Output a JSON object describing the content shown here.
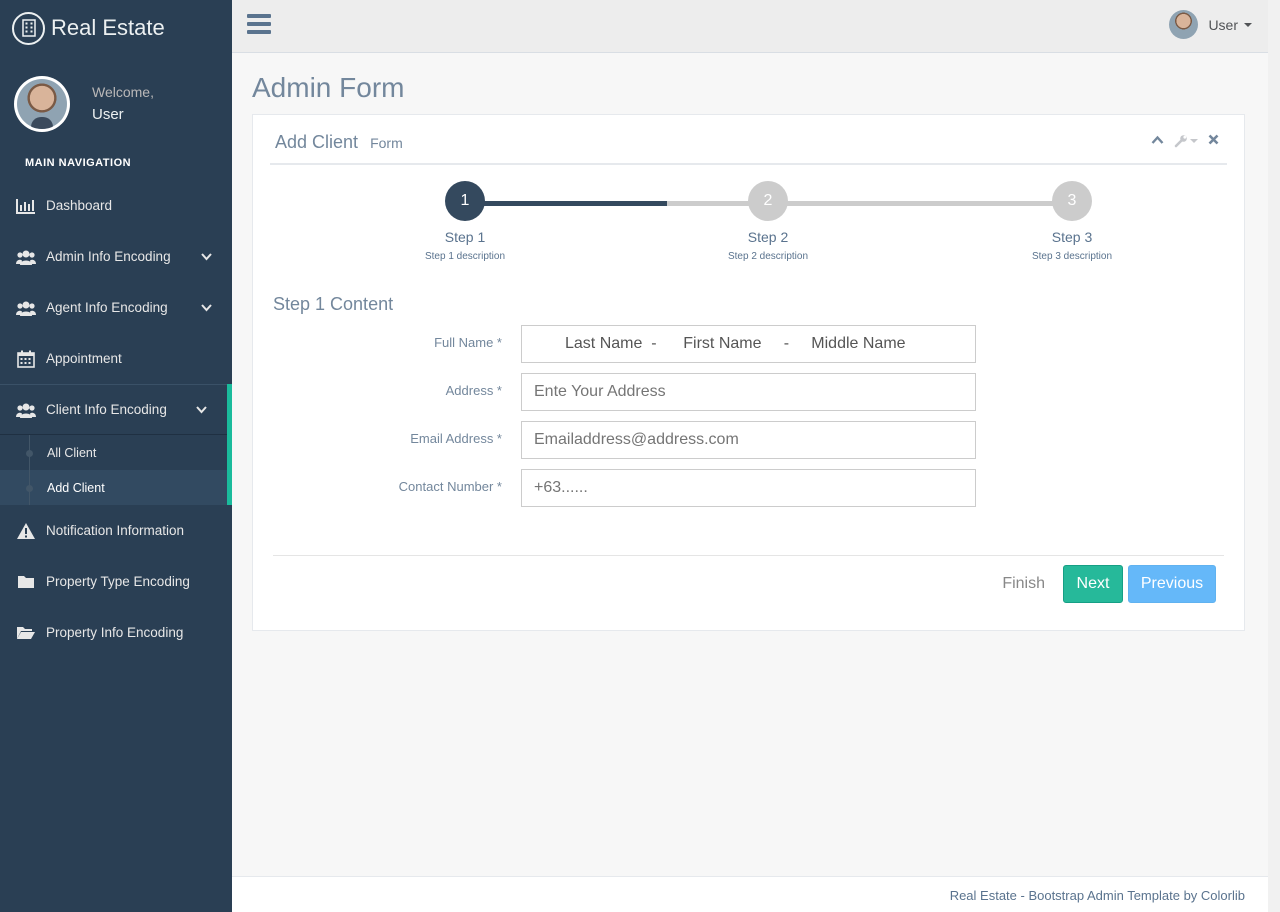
{
  "brand": {
    "title": "Real Estate",
    "icon": "building-icon"
  },
  "profile": {
    "welcome": "Welcome,",
    "name": "User"
  },
  "sidebar": {
    "section_title": "MAIN NAVIGATION",
    "items": [
      {
        "label": "Dashboard",
        "icon": "bar-chart-icon"
      },
      {
        "label": "Admin Info Encoding",
        "icon": "users-icon",
        "expandable": true
      },
      {
        "label": "Agent Info Encoding",
        "icon": "users-icon",
        "expandable": true
      },
      {
        "label": "Appointment",
        "icon": "calendar-icon"
      },
      {
        "label": "Client Info Encoding",
        "icon": "users-icon",
        "expandable": true,
        "active": true
      },
      {
        "label": "Notification Information",
        "icon": "warning-icon"
      },
      {
        "label": "Property Type Encoding",
        "icon": "folder-icon"
      },
      {
        "label": "Property Info Encoding",
        "icon": "folder-open-icon"
      }
    ],
    "client_sub_items": [
      {
        "label": "All Client"
      },
      {
        "label": "Add Client",
        "current": true
      }
    ]
  },
  "topnav": {
    "user_label": "User"
  },
  "page": {
    "title": "Admin Form"
  },
  "panel": {
    "title": "Add Client",
    "subtitle": "Form"
  },
  "wizard": {
    "progress_fraction": 0.25,
    "steps": [
      {
        "number": "1",
        "label": "Step 1",
        "description": "Step 1 description",
        "done": true
      },
      {
        "number": "2",
        "label": "Step 2",
        "description": "Step 2 description",
        "done": false
      },
      {
        "number": "3",
        "label": "Step 3",
        "description": "Step 3 description",
        "done": false
      }
    ],
    "content_title": "Step 1 Content"
  },
  "form": {
    "full_name": {
      "label": "Full Name *",
      "last": "Last Name",
      "sep1": "  -      ",
      "first": "First Name",
      "sep2": "     -     ",
      "middle": "Middle Name"
    },
    "address": {
      "label": "Address *",
      "placeholder": "Ente Your Address"
    },
    "email": {
      "label": "Email Address *",
      "placeholder": "Emailaddress@address.com"
    },
    "contact": {
      "label": "Contact Number *",
      "placeholder": "+63......"
    }
  },
  "actions": {
    "finish": "Finish",
    "next": "Next",
    "previous": "Previous"
  },
  "footer": {
    "text": "Real Estate - Bootstrap Admin Template by ",
    "link": "Colorlib"
  },
  "colors": {
    "sidebar_bg": "#2A3F54",
    "accent": "#1ABB9C",
    "next_button": "#26B99A",
    "previous_button": "#5DB5F9",
    "step_done": "#34495E"
  }
}
